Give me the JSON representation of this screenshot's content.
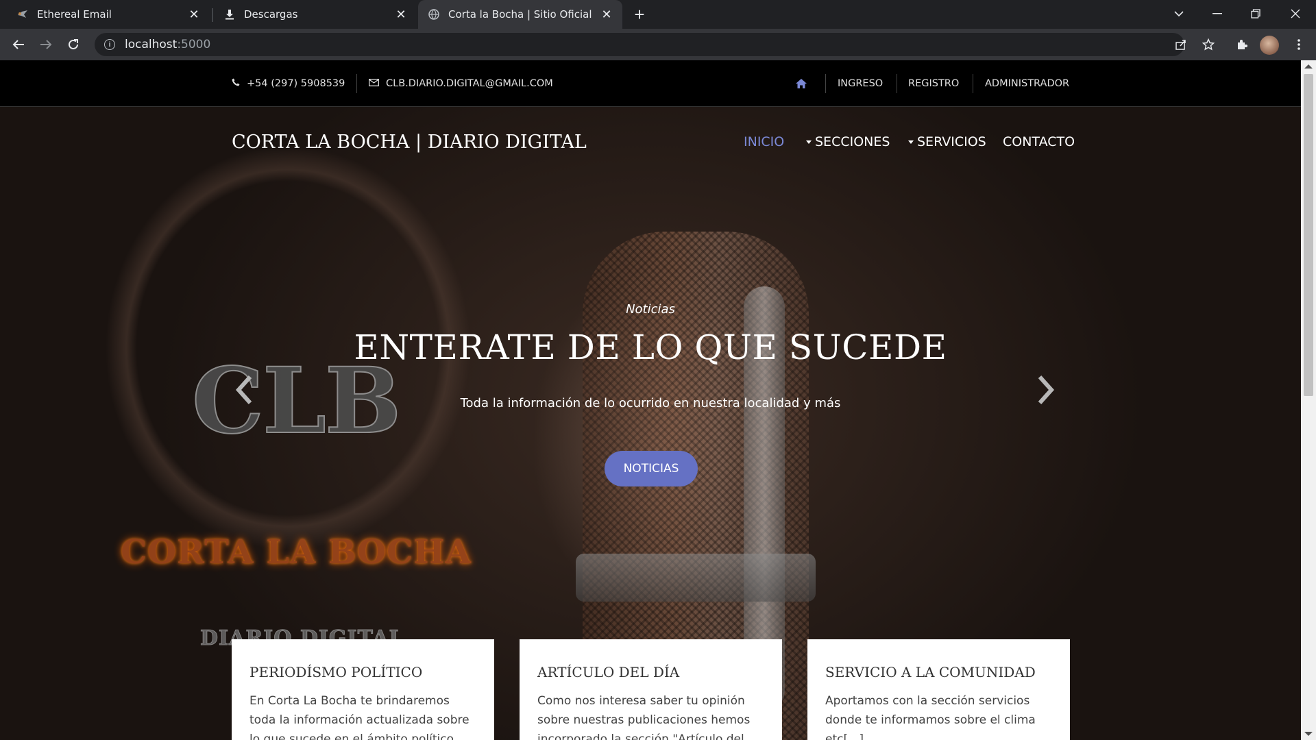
{
  "browser": {
    "tabs": [
      {
        "title": "Ethereal Email",
        "icon": "ethereal-favicon"
      },
      {
        "title": "Descargas",
        "icon": "download-icon"
      },
      {
        "title": "Corta la Bocha | Sitio Oficial",
        "icon": "globe-icon"
      }
    ],
    "url_host": "localhost",
    "url_port": ":5000"
  },
  "topbar": {
    "phone": "+54 (297) 5908539",
    "email": "CLB.DIARIO.DIGITAL@GMAIL.COM",
    "links": [
      "INGRESO",
      "REGISTRO",
      "ADMINISTRADOR"
    ]
  },
  "nav": {
    "brand": "CORTA LA BOCHA | DIARIO DIGITAL",
    "items": [
      "INICIO",
      "SECCIONES",
      "SERVICIOS",
      "CONTACTO"
    ],
    "active": "INICIO",
    "accent": "#7b89d6"
  },
  "hero": {
    "kicker": "Noticias",
    "title": "ENTERATE DE LO QUE SUCEDE",
    "subtitle": "Toda la información de lo ocurrido en nuestra localidad y más",
    "button": "NOTICIAS",
    "button_color": "#6571c4",
    "logo": {
      "mark": "CLB",
      "name": "CORTA LA BOCHA",
      "tagline": "DIARIO DIGITAL"
    }
  },
  "cards": [
    {
      "title": "PERIODÍSMO POLÍTICO",
      "text": "En Corta La Bocha te brindaremos toda la información actualizada sobre lo que sucede en el ámbito político"
    },
    {
      "title": "ARTÍCULO DEL DÍA",
      "text": "Como nos interesa saber tu opinión sobre nuestras publicaciones hemos incorporado la sección \"Artículo del"
    },
    {
      "title": "SERVICIO A LA COMUNIDAD",
      "text": "Aportamos con la sección servicios donde te informamos sobre el clima etc[...]"
    }
  ]
}
